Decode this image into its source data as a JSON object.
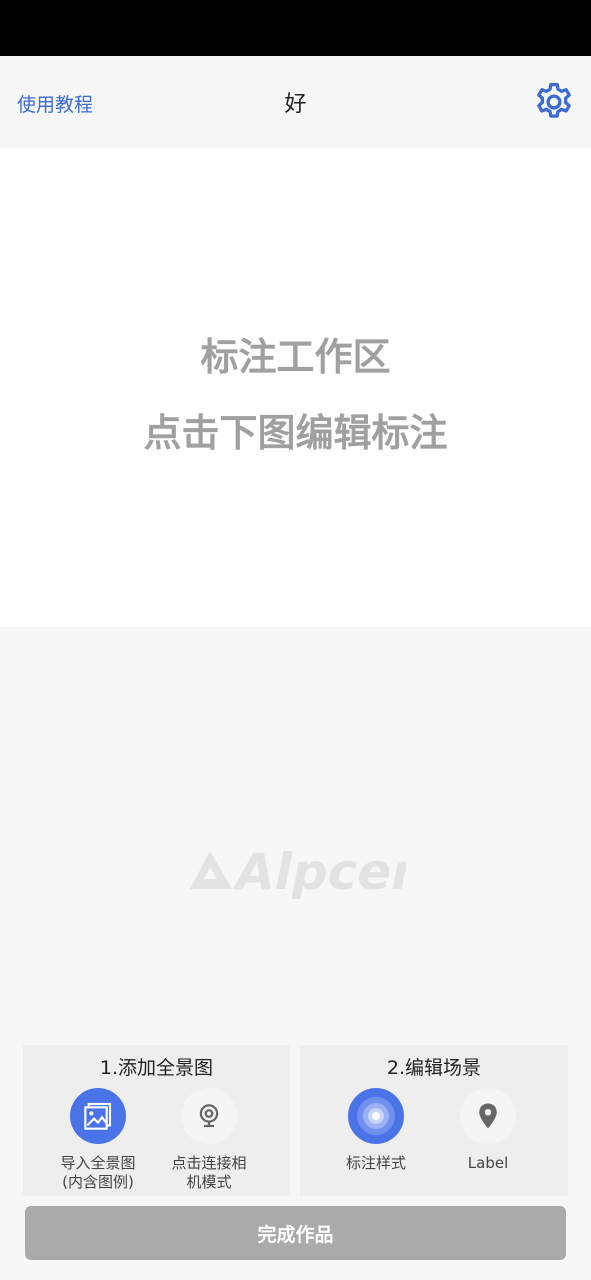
{
  "header": {
    "tutorial_link": "使用教程",
    "title": "好"
  },
  "work_area": {
    "line1": "标注工作区",
    "line2": "点击下图编辑标注"
  },
  "logo_text": "Alpcer",
  "add_panorama": {
    "title": "1.添加全景图",
    "import_label": "导入全景图\n(内含图例)",
    "camera_label": "点击连接相\n机模式"
  },
  "edit_scene": {
    "title": "2.编辑场景",
    "marker_style_label": "标注样式",
    "label_label": "Label"
  },
  "finish_button": "完成作品",
  "colors": {
    "accent": "#4a73e8",
    "link": "#3d6bd2",
    "disabled_button": "#aaaaaa"
  }
}
